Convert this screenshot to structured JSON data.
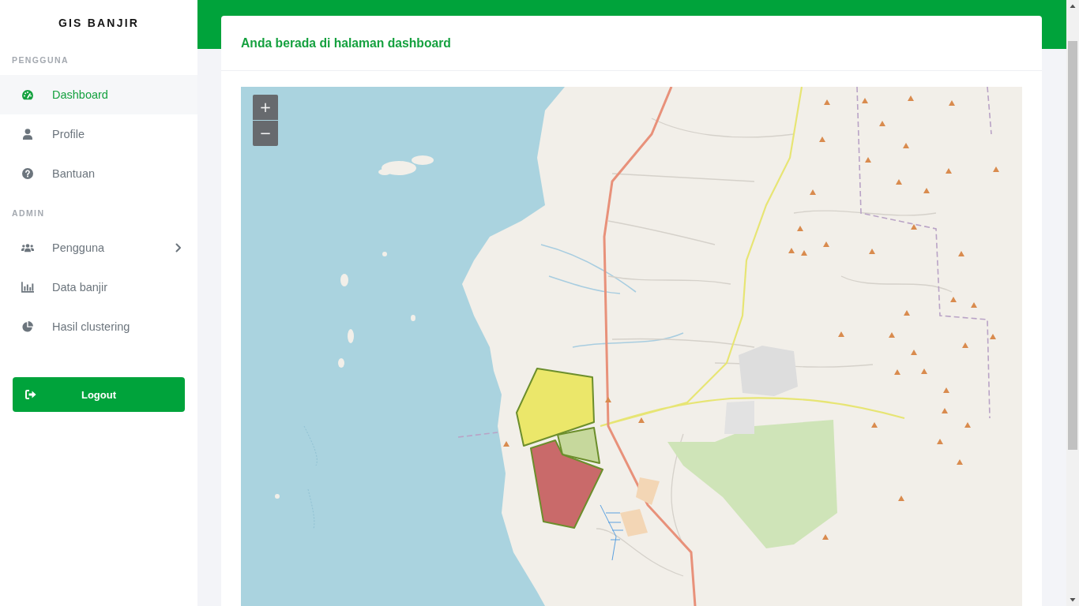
{
  "sidebar": {
    "brand": "GIS BANJIR",
    "sections": [
      {
        "title": "PENGGUNA",
        "items": [
          {
            "label": "Dashboard",
            "kind": "link",
            "selected": true
          },
          {
            "label": "Profile",
            "kind": "link",
            "selected": false
          },
          {
            "label": "Bantuan",
            "kind": "link",
            "selected": false
          }
        ]
      },
      {
        "title": "ADMIN",
        "items": [
          {
            "label": "Pengguna",
            "kind": "submenu",
            "expanded": false,
            "selected": false
          },
          {
            "label": "Data banjir",
            "kind": "link",
            "selected": false
          },
          {
            "label": "Hasil clustering",
            "kind": "link",
            "selected": false
          }
        ]
      }
    ],
    "logout_button": "Logout"
  },
  "card": {
    "title": "Anda berada di halaman dashboard"
  },
  "map": {
    "zoom_controls": [
      "+",
      "−"
    ],
    "flood_zones": [
      {
        "color": "#ebe76a"
      },
      {
        "color": "#c6d89c"
      },
      {
        "color": "#c96a6a"
      }
    ]
  }
}
